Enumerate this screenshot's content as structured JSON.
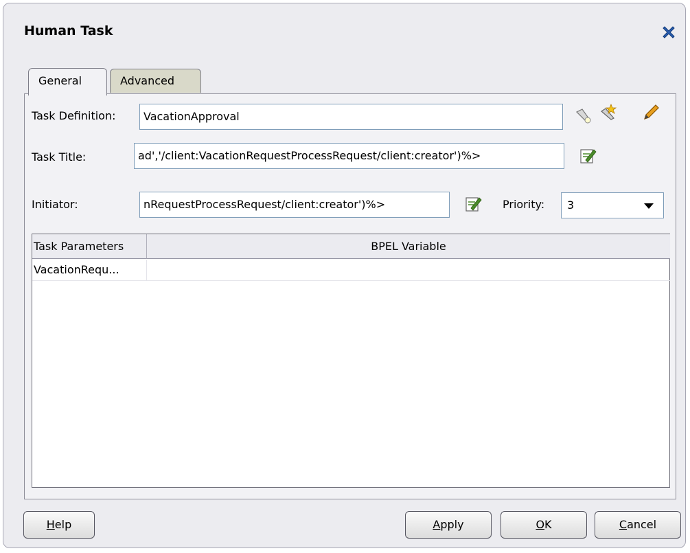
{
  "window": {
    "title": "Human Task"
  },
  "tabs": [
    {
      "label": "General",
      "selected": true
    },
    {
      "label": "Advanced",
      "selected": false
    }
  ],
  "form": {
    "task_definition_label": "Task Definition:",
    "task_definition_value": "VacationApproval",
    "task_title_label": "Task Title:",
    "task_title_value": "ad','/client:VacationRequestProcessRequest/client:creator')%>",
    "initiator_label": "Initiator:",
    "initiator_value": "nRequestProcessRequest/client:creator')%>",
    "priority_label": "Priority:",
    "priority_value": "3"
  },
  "table": {
    "columns": [
      "Task Parameters",
      "BPEL Variable"
    ],
    "rows": [
      {
        "task_parameter": "VacationRequ...",
        "bpel_variable": ""
      }
    ]
  },
  "buttons": {
    "help": {
      "mnemonic": "H",
      "rest": "elp"
    },
    "apply": {
      "mnemonic": "A",
      "rest": "pply"
    },
    "ok": {
      "mnemonic": "O",
      "rest": "K"
    },
    "cancel": {
      "mnemonic": "C",
      "rest": "ancel"
    }
  },
  "icons": {
    "close": "close-icon",
    "search": "flashlight-icon",
    "create": "wand-icon",
    "edit": "pencil-icon",
    "expression_builder": "edit-expression-icon"
  },
  "colors": {
    "close_icon": "#2a5fb0",
    "pencil": "#e8a020"
  }
}
